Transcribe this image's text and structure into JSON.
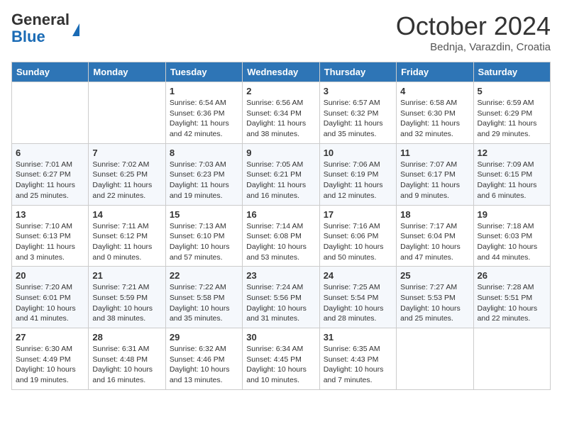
{
  "header": {
    "logo_general": "General",
    "logo_blue": "Blue",
    "month": "October 2024",
    "location": "Bednja, Varazdin, Croatia"
  },
  "days_of_week": [
    "Sunday",
    "Monday",
    "Tuesday",
    "Wednesday",
    "Thursday",
    "Friday",
    "Saturday"
  ],
  "weeks": [
    [
      {
        "day": "",
        "sunrise": "",
        "sunset": "",
        "daylight": ""
      },
      {
        "day": "",
        "sunrise": "",
        "sunset": "",
        "daylight": ""
      },
      {
        "day": "1",
        "sunrise": "Sunrise: 6:54 AM",
        "sunset": "Sunset: 6:36 PM",
        "daylight": "Daylight: 11 hours and 42 minutes."
      },
      {
        "day": "2",
        "sunrise": "Sunrise: 6:56 AM",
        "sunset": "Sunset: 6:34 PM",
        "daylight": "Daylight: 11 hours and 38 minutes."
      },
      {
        "day": "3",
        "sunrise": "Sunrise: 6:57 AM",
        "sunset": "Sunset: 6:32 PM",
        "daylight": "Daylight: 11 hours and 35 minutes."
      },
      {
        "day": "4",
        "sunrise": "Sunrise: 6:58 AM",
        "sunset": "Sunset: 6:30 PM",
        "daylight": "Daylight: 11 hours and 32 minutes."
      },
      {
        "day": "5",
        "sunrise": "Sunrise: 6:59 AM",
        "sunset": "Sunset: 6:29 PM",
        "daylight": "Daylight: 11 hours and 29 minutes."
      }
    ],
    [
      {
        "day": "6",
        "sunrise": "Sunrise: 7:01 AM",
        "sunset": "Sunset: 6:27 PM",
        "daylight": "Daylight: 11 hours and 25 minutes."
      },
      {
        "day": "7",
        "sunrise": "Sunrise: 7:02 AM",
        "sunset": "Sunset: 6:25 PM",
        "daylight": "Daylight: 11 hours and 22 minutes."
      },
      {
        "day": "8",
        "sunrise": "Sunrise: 7:03 AM",
        "sunset": "Sunset: 6:23 PM",
        "daylight": "Daylight: 11 hours and 19 minutes."
      },
      {
        "day": "9",
        "sunrise": "Sunrise: 7:05 AM",
        "sunset": "Sunset: 6:21 PM",
        "daylight": "Daylight: 11 hours and 16 minutes."
      },
      {
        "day": "10",
        "sunrise": "Sunrise: 7:06 AM",
        "sunset": "Sunset: 6:19 PM",
        "daylight": "Daylight: 11 hours and 12 minutes."
      },
      {
        "day": "11",
        "sunrise": "Sunrise: 7:07 AM",
        "sunset": "Sunset: 6:17 PM",
        "daylight": "Daylight: 11 hours and 9 minutes."
      },
      {
        "day": "12",
        "sunrise": "Sunrise: 7:09 AM",
        "sunset": "Sunset: 6:15 PM",
        "daylight": "Daylight: 11 hours and 6 minutes."
      }
    ],
    [
      {
        "day": "13",
        "sunrise": "Sunrise: 7:10 AM",
        "sunset": "Sunset: 6:13 PM",
        "daylight": "Daylight: 11 hours and 3 minutes."
      },
      {
        "day": "14",
        "sunrise": "Sunrise: 7:11 AM",
        "sunset": "Sunset: 6:12 PM",
        "daylight": "Daylight: 11 hours and 0 minutes."
      },
      {
        "day": "15",
        "sunrise": "Sunrise: 7:13 AM",
        "sunset": "Sunset: 6:10 PM",
        "daylight": "Daylight: 10 hours and 57 minutes."
      },
      {
        "day": "16",
        "sunrise": "Sunrise: 7:14 AM",
        "sunset": "Sunset: 6:08 PM",
        "daylight": "Daylight: 10 hours and 53 minutes."
      },
      {
        "day": "17",
        "sunrise": "Sunrise: 7:16 AM",
        "sunset": "Sunset: 6:06 PM",
        "daylight": "Daylight: 10 hours and 50 minutes."
      },
      {
        "day": "18",
        "sunrise": "Sunrise: 7:17 AM",
        "sunset": "Sunset: 6:04 PM",
        "daylight": "Daylight: 10 hours and 47 minutes."
      },
      {
        "day": "19",
        "sunrise": "Sunrise: 7:18 AM",
        "sunset": "Sunset: 6:03 PM",
        "daylight": "Daylight: 10 hours and 44 minutes."
      }
    ],
    [
      {
        "day": "20",
        "sunrise": "Sunrise: 7:20 AM",
        "sunset": "Sunset: 6:01 PM",
        "daylight": "Daylight: 10 hours and 41 minutes."
      },
      {
        "day": "21",
        "sunrise": "Sunrise: 7:21 AM",
        "sunset": "Sunset: 5:59 PM",
        "daylight": "Daylight: 10 hours and 38 minutes."
      },
      {
        "day": "22",
        "sunrise": "Sunrise: 7:22 AM",
        "sunset": "Sunset: 5:58 PM",
        "daylight": "Daylight: 10 hours and 35 minutes."
      },
      {
        "day": "23",
        "sunrise": "Sunrise: 7:24 AM",
        "sunset": "Sunset: 5:56 PM",
        "daylight": "Daylight: 10 hours and 31 minutes."
      },
      {
        "day": "24",
        "sunrise": "Sunrise: 7:25 AM",
        "sunset": "Sunset: 5:54 PM",
        "daylight": "Daylight: 10 hours and 28 minutes."
      },
      {
        "day": "25",
        "sunrise": "Sunrise: 7:27 AM",
        "sunset": "Sunset: 5:53 PM",
        "daylight": "Daylight: 10 hours and 25 minutes."
      },
      {
        "day": "26",
        "sunrise": "Sunrise: 7:28 AM",
        "sunset": "Sunset: 5:51 PM",
        "daylight": "Daylight: 10 hours and 22 minutes."
      }
    ],
    [
      {
        "day": "27",
        "sunrise": "Sunrise: 6:30 AM",
        "sunset": "Sunset: 4:49 PM",
        "daylight": "Daylight: 10 hours and 19 minutes."
      },
      {
        "day": "28",
        "sunrise": "Sunrise: 6:31 AM",
        "sunset": "Sunset: 4:48 PM",
        "daylight": "Daylight: 10 hours and 16 minutes."
      },
      {
        "day": "29",
        "sunrise": "Sunrise: 6:32 AM",
        "sunset": "Sunset: 4:46 PM",
        "daylight": "Daylight: 10 hours and 13 minutes."
      },
      {
        "day": "30",
        "sunrise": "Sunrise: 6:34 AM",
        "sunset": "Sunset: 4:45 PM",
        "daylight": "Daylight: 10 hours and 10 minutes."
      },
      {
        "day": "31",
        "sunrise": "Sunrise: 6:35 AM",
        "sunset": "Sunset: 4:43 PM",
        "daylight": "Daylight: 10 hours and 7 minutes."
      },
      {
        "day": "",
        "sunrise": "",
        "sunset": "",
        "daylight": ""
      },
      {
        "day": "",
        "sunrise": "",
        "sunset": "",
        "daylight": ""
      }
    ]
  ]
}
